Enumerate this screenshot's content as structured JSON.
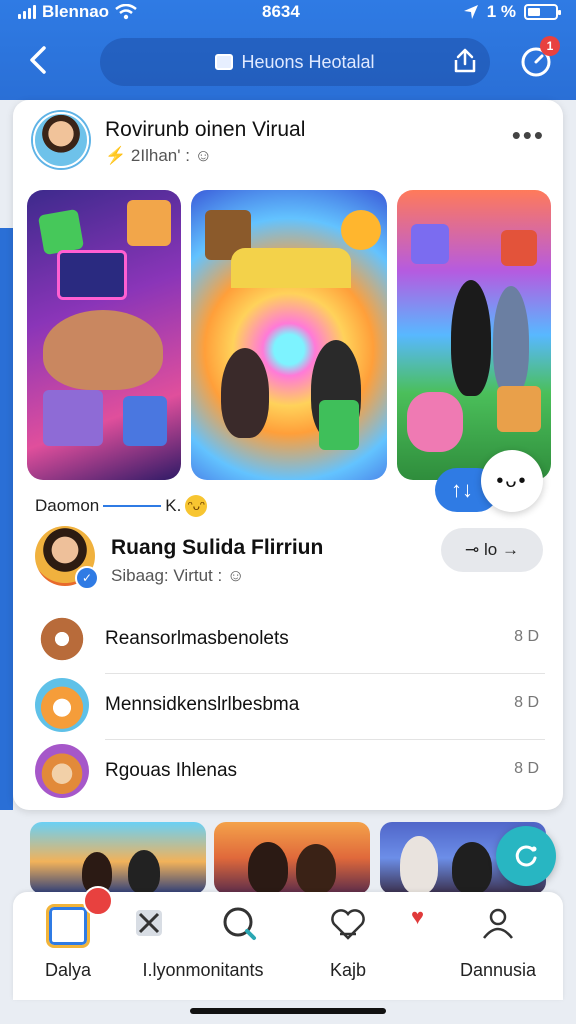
{
  "status_bar": {
    "carrier": "Blennao",
    "time": "8634",
    "right_text": "1 %"
  },
  "header": {
    "title": "Heuons Heotalal"
  },
  "notifications": {
    "badge": "1"
  },
  "post": {
    "author": "Rovirunb oinen Virual",
    "subtitle": "2Ilhan' :",
    "more_label": "•••"
  },
  "reaction_line": {
    "left_text": "Daomon",
    "right_text": "K."
  },
  "profile": {
    "name": "Ruang Sulida Flirriun",
    "subtitle": "Sibaag: Virtut :",
    "follow_label": "lo"
  },
  "list": [
    {
      "label": "Reansorlmasbenolets",
      "meta": "8 D"
    },
    {
      "label": "Mennsidkenslrlbesbma",
      "meta": "8 D"
    },
    {
      "label": "Rgouas Ihlenas",
      "meta": "8 D"
    }
  ],
  "tabs": [
    {
      "label": "Dalya",
      "icon": "home-icon"
    },
    {
      "label": "I.lyonmonitants",
      "icon": "search-icon"
    },
    {
      "label": "Kajb",
      "icon": "heart-hands-icon"
    },
    {
      "label": "Dannusia",
      "icon": "profile-icon"
    }
  ],
  "colors": {
    "header_blue": "#2f7be4",
    "fab_teal": "#28b6c2",
    "badge_red": "#e8413f"
  }
}
